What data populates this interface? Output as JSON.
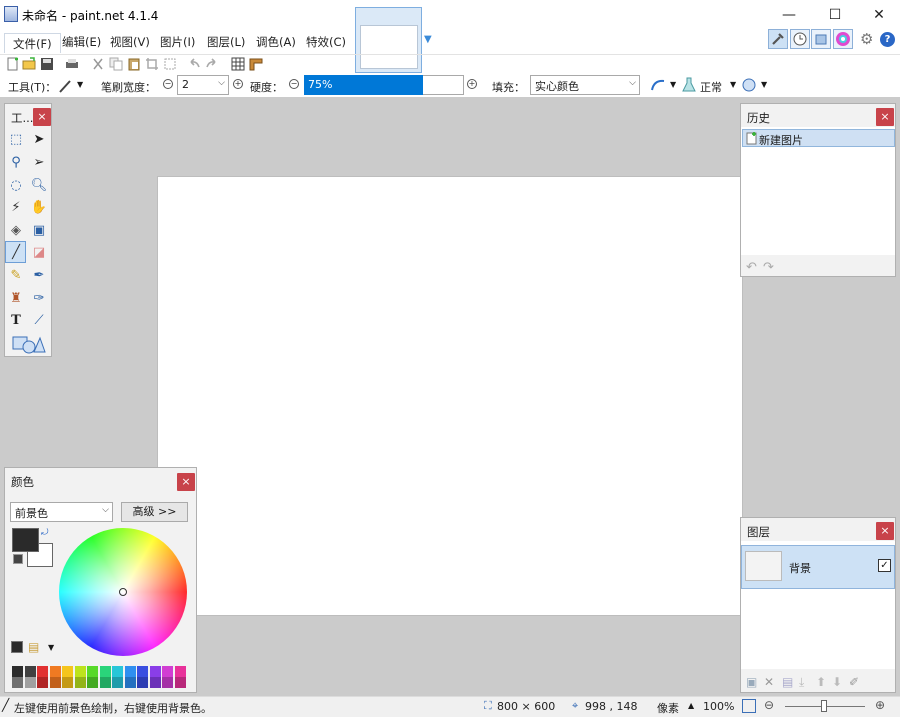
{
  "window": {
    "title": "未命名 - paint.net 4.1.4",
    "min_label": "—",
    "max_label": "☐",
    "close_label": "✕"
  },
  "menu": {
    "items": [
      "文件(F)",
      "编辑(E)",
      "视图(V)",
      "图片(I)",
      "图层(L)",
      "调色(A)",
      "特效(C)"
    ]
  },
  "toolbar2": {
    "tool_label": "工具(T)：",
    "brush_width_label": "笔刷宽度：",
    "brush_width_value": "2",
    "hardness_label": "硬度：",
    "hardness_value": "75%",
    "hardness_fraction": 0.75,
    "fill_label": "填充：",
    "fill_value": "实心颜色",
    "blend_value": "正常"
  },
  "tools_panel": {
    "title": "工...",
    "close": "×"
  },
  "history_panel": {
    "title": "历史",
    "close": "×",
    "items": [
      "新建图片"
    ]
  },
  "layers_panel": {
    "title": "图层",
    "close": "×",
    "layer_name": "背景",
    "check": "✓"
  },
  "colors_panel": {
    "title": "颜色",
    "close": "×",
    "mode_value": "前景色",
    "advanced_label": "高级 >>"
  },
  "palette_colors": [
    "#2b2b2b",
    "#404040",
    "#e13131",
    "#f07a22",
    "#f5c51d",
    "#bde31d",
    "#58d92a",
    "#2ad47a",
    "#27c6d8",
    "#2f8ff0",
    "#3a4fe0",
    "#8a3ee8",
    "#d13ed2",
    "#e8329a",
    "#707070",
    "#a0a0a0",
    "#b02424",
    "#c2601a",
    "#c49a15",
    "#93b418",
    "#44aa22",
    "#21a862",
    "#1f9cab",
    "#2470c0",
    "#2d3db3",
    "#6c30b8",
    "#a530a6",
    "#b8287a"
  ],
  "status": {
    "hint": "左键使用前景色绘制，右键使用背景色。",
    "image_size": "800 × 600",
    "cursor_pos": "998 , 148",
    "units": "像素",
    "zoom": "100%"
  },
  "colors": {
    "accent": "#0078d7",
    "workspace": "#cbcbcb",
    "close_red": "#c8434a"
  }
}
